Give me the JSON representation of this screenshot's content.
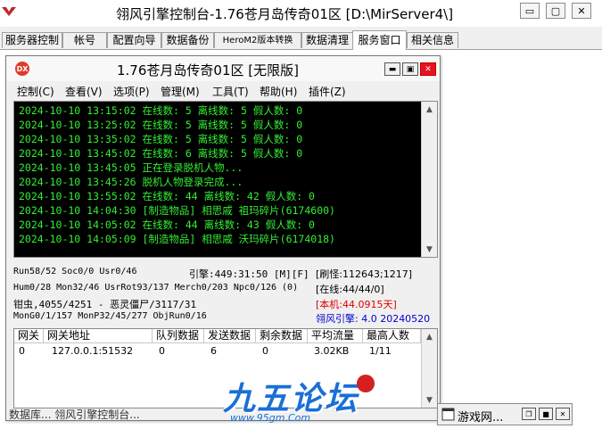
{
  "outer": {
    "title": "翎风引擎控制台-1.76苍月岛传奇01区 [D:\\MirServer4\\]",
    "min_glyph": "▭",
    "max_glyph": "▢",
    "close_glyph": "✕"
  },
  "tabs": [
    {
      "label": "服务器控制"
    },
    {
      "label": "帐号"
    },
    {
      "label": "配置向导"
    },
    {
      "label": "数据备份"
    },
    {
      "label": "HeroM2版本转换"
    },
    {
      "label": "数据清理"
    },
    {
      "label": "服务窗口"
    },
    {
      "label": "相关信息"
    }
  ],
  "inner": {
    "icon_text": "DX",
    "title": "1.76苍月岛传奇01区 [无限版]",
    "min_glyph": "▬",
    "max_glyph": "▣",
    "close_glyph": "✕",
    "menu": [
      "控制(C)",
      "查看(V)",
      "选项(P)",
      "管理(M)",
      "工具(T)",
      "帮助(H)",
      "插件(Z)"
    ]
  },
  "log_lines": [
    "2024-10-10 13:15:02 在线数: 5 离线数: 5 假人数: 0",
    "2024-10-10 13:25:02 在线数: 5 离线数: 5 假人数: 0",
    "2024-10-10 13:35:02 在线数: 5 离线数: 5 假人数: 0",
    "2024-10-10 13:45:02 在线数: 6 离线数: 5 假人数: 0",
    "2024-10-10 13:45:05 正在登录脱机人物...",
    "2024-10-10 13:45:26 脱机人物登录完成...",
    "2024-10-10 13:55:02 在线数: 44 离线数: 42 假人数: 0",
    "2024-10-10 14:04:30 [制造物品] 相思戚 祖玛碎片(6174600)",
    "2024-10-10 14:05:02 在线数: 44 离线数: 43 假人数: 0",
    "2024-10-10 14:05:09 [制造物品] 相思戚 沃玛碎片(6174018)"
  ],
  "status": {
    "run": "Run58/52 Soc0/0 Usr0/46",
    "engine": "引擎:449:31:50 [M][F]",
    "refresh": "[刷怪:112643;1217]",
    "hum": "Hum0/28 Mon32/46 UsrRot93/137 Merch0/203 Npc0/126 (0)",
    "online": "[在线:44/44/0]",
    "monster": "钳虫,4055/4251 - 恶灵僵尸/3117/31",
    "local": "[本机:44.0915天]",
    "mon_gen": "MonG0/1/157 MonP32/45/277 ObjRun0/16",
    "version": "翎风引擎: 4.0 20240520",
    "local_color": "#e00000",
    "version_color": "#0000cc"
  },
  "gateway": {
    "headers": [
      "网关",
      "网关地址",
      "队列数据",
      "发送数据",
      "剩余数据",
      "平均流量",
      "最高人数"
    ],
    "rows": [
      [
        "0",
        "127.0.0.1:51532",
        "0",
        "6",
        "0",
        "3.02KB",
        "1/11"
      ]
    ]
  },
  "taskbar": {
    "left_item": "数据库...  翎风引擎控制台...",
    "minimized_title": "游戏网..."
  },
  "watermark": {
    "logo_text": "九五论坛",
    "url": "www.95gm.Com"
  },
  "colors": {
    "console_bg": "#000000",
    "console_text": "#33ee33",
    "close_red": "#e81123",
    "watermark_blue": "#1a6fd6"
  }
}
